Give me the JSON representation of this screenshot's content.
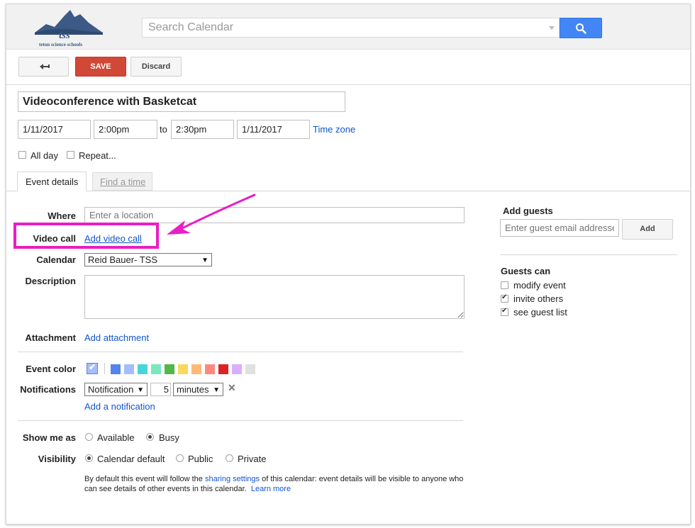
{
  "header": {
    "logo_text": "tss",
    "logo_subtext": "teton science schools",
    "search_placeholder": "Search Calendar"
  },
  "toolbar": {
    "back_icon": "back-arrow-icon",
    "save_label": "SAVE",
    "discard_label": "Discard"
  },
  "event": {
    "title": "Videoconference with Basketcat",
    "start_date": "1/11/2017",
    "start_time": "2:00pm",
    "to_label": "to",
    "end_time": "2:30pm",
    "end_date": "1/11/2017",
    "timezone_link": "Time zone",
    "all_day_label": "All day",
    "repeat_label": "Repeat..."
  },
  "tabs": [
    {
      "label": "Event details",
      "active": true
    },
    {
      "label": "Find a time",
      "active": false
    }
  ],
  "details": {
    "where_label": "Where",
    "where_placeholder": "Enter a location",
    "video_call_label": "Video call",
    "video_call_link": "Add video call",
    "calendar_label": "Calendar",
    "calendar_value": "Reid Bauer- TSS",
    "description_label": "Description",
    "attachment_label": "Attachment",
    "attachment_link": "Add attachment",
    "event_color_label": "Event color",
    "event_colors": [
      "#a4bdfc",
      "#5484ed",
      "#a4bdfc",
      "#46d6db",
      "#7ae7bf",
      "#51b749",
      "#fbd75b",
      "#ffb878",
      "#ff887c",
      "#dc2127",
      "#dbadff",
      "#e1e1e1"
    ],
    "notifications_label": "Notifications",
    "notification_type": "Notification",
    "notification_amount": "5",
    "notification_unit": "minutes",
    "add_notification_link": "Add a notification",
    "show_me_as_label": "Show me as",
    "show_available": "Available",
    "show_busy": "Busy",
    "visibility_label": "Visibility",
    "visibility_default": "Calendar default",
    "visibility_public": "Public",
    "visibility_private": "Private",
    "footnote_prefix": "By default this event will follow the ",
    "footnote_link": "sharing settings",
    "footnote_mid": " of this calendar: event details will be visible to anyone who",
    "footnote_line2": "can see details of other events in this calendar.",
    "footnote_learn_more": "Learn more"
  },
  "guests": {
    "add_guests_label": "Add guests",
    "guest_placeholder": "Enter guest email addresses",
    "add_button": "Add",
    "guests_can_label": "Guests can",
    "permissions": [
      {
        "label": "modify event",
        "checked": false
      },
      {
        "label": "invite others",
        "checked": true
      },
      {
        "label": "see guest list",
        "checked": true
      }
    ]
  },
  "annotation": {
    "highlight_color": "#e91ec4"
  }
}
